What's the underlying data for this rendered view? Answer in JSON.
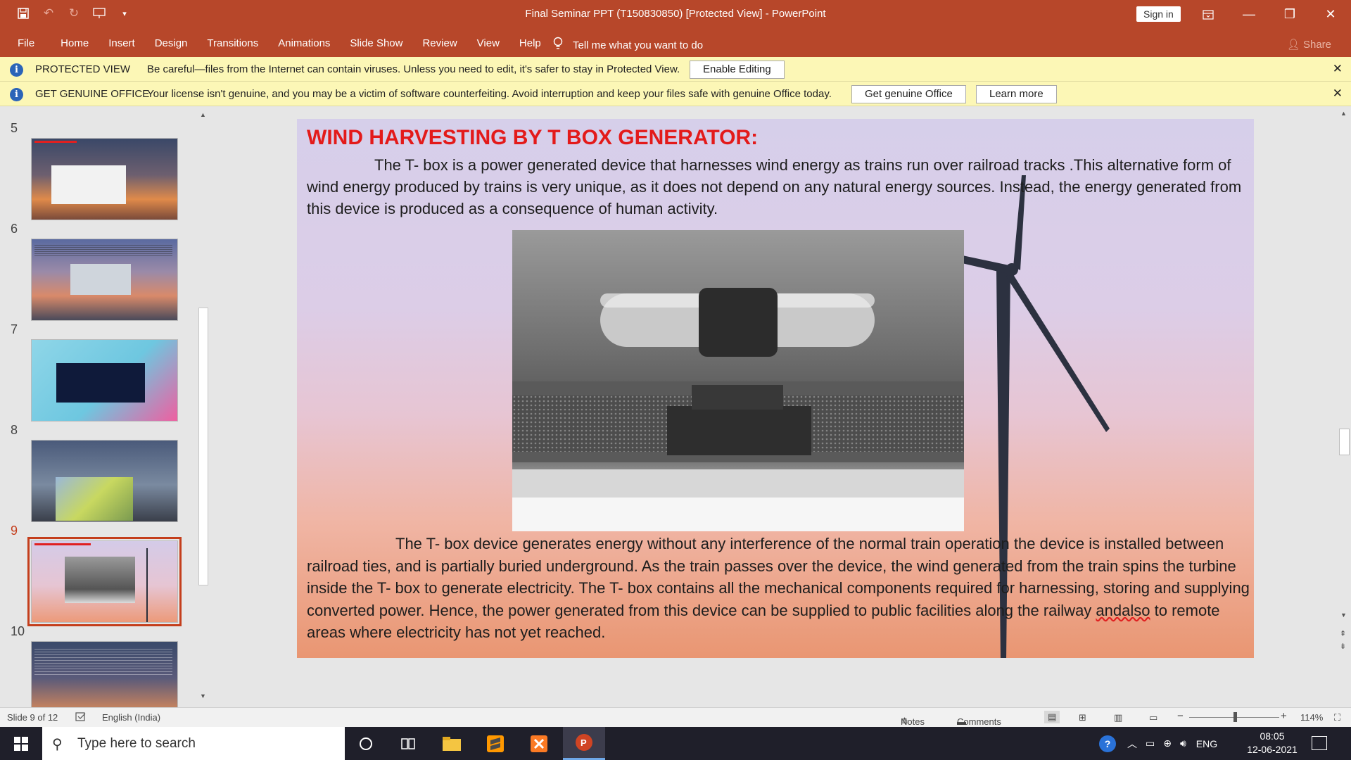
{
  "window": {
    "title": "Final Seminar PPT (T150830850) [Protected View]  -  PowerPoint",
    "signin_label": "Sign in"
  },
  "ribbon": {
    "tabs": [
      "File",
      "Home",
      "Insert",
      "Design",
      "Transitions",
      "Animations",
      "Slide Show",
      "Review",
      "View",
      "Help"
    ],
    "tell_me": "Tell me what you want to do",
    "share": "Share"
  },
  "protected_bar": {
    "label": "PROTECTED VIEW",
    "message": "Be careful—files from the Internet can contain viruses. Unless you need to edit, it's safer to stay in Protected View.",
    "button": "Enable Editing"
  },
  "genuine_bar": {
    "label": "GET GENUINE OFFICE",
    "message": "Your license isn't genuine, and you may be a victim of software counterfeiting. Avoid interruption and keep your files safe with genuine Office today.",
    "button1": "Get genuine Office",
    "button2": "Learn more"
  },
  "thumbnails": [
    {
      "num": "5",
      "theme": "sunset"
    },
    {
      "num": "6",
      "theme": "dusk"
    },
    {
      "num": "7",
      "theme": "cyan"
    },
    {
      "num": "8",
      "theme": "field"
    },
    {
      "num": "9",
      "theme": "pink",
      "selected": true
    },
    {
      "num": "10",
      "theme": "evening"
    }
  ],
  "slide": {
    "title": "WIND HARVESTING BY T BOX GENERATOR:",
    "para1": "The T- box is a power generated device that harnesses wind energy as trains run over railroad tracks .This alternative form of wind energy produced by trains is very unique, as it does not depend on any natural energy sources. Instead, the energy generated from this device is produced as a consequence of human activity.",
    "para2_part1": "The T- box device generates energy without any interference of the normal train operation the device is installed between railroad ties, and is partially buried underground. As the train passes over the device, the wind generated from the train spins the turbine inside the T- box to generate electricity. The T- box contains all the mechanical components required for harnessing, storing and supplying converted power. Hence, the power generated from this device can be supplied to public facilities along the railway ",
    "para2_misspelled": "andalso",
    "para2_part2": " to remote areas where electricity has not yet reached."
  },
  "status": {
    "slide_info": "Slide 9 of 12",
    "language": "English (India)",
    "notes": "Notes",
    "comments": "Comments",
    "zoom": "114%"
  },
  "taskbar": {
    "search_placeholder": "Type here to search",
    "language": "ENG",
    "time": "08:05",
    "date": "12-06-2021"
  }
}
